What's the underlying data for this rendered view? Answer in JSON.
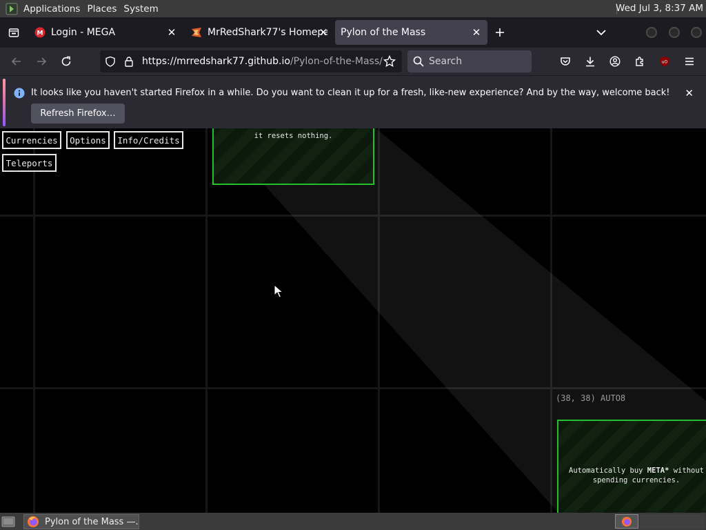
{
  "top_panel": {
    "menus": [
      "Applications",
      "Places",
      "System"
    ],
    "clock": "Wed Jul  3,  8:37 AM"
  },
  "tabs": [
    {
      "title": "Login - MEGA",
      "active": false,
      "favicon": "mega-icon"
    },
    {
      "title": "MrRedShark77's Homepage",
      "active": false,
      "favicon": "shark-icon"
    },
    {
      "title": "Pylon of the Mass",
      "active": true,
      "favicon": ""
    }
  ],
  "navbar": {
    "url_host": "https://mrredshark77.github.io",
    "url_path": "/Pylon-of-the-Mass/",
    "search_placeholder": "Search"
  },
  "notification": {
    "message": "It looks like you haven't started Firefox in a while. Do you want to clean it up for a fresh, like-new experience? And by the way, welcome back!",
    "button": "Refresh Firefox…"
  },
  "game": {
    "buttons": [
      "Currencies",
      "Options",
      "Info/Credits",
      "Teleports"
    ],
    "top_card_text": "it resets nothing.",
    "coord_label": "(38, 38) AUTO8",
    "bottom_card": {
      "line1_prefix": "Automatically buy ",
      "line1_bold": "META*",
      "line1_suffix": " without",
      "line2": "spending currencies."
    }
  },
  "taskbar": {
    "task_title": "Pylon of the Mass —..."
  },
  "colors": {
    "card_border": "#22c02a",
    "accent_ublock": "#8b0000"
  }
}
